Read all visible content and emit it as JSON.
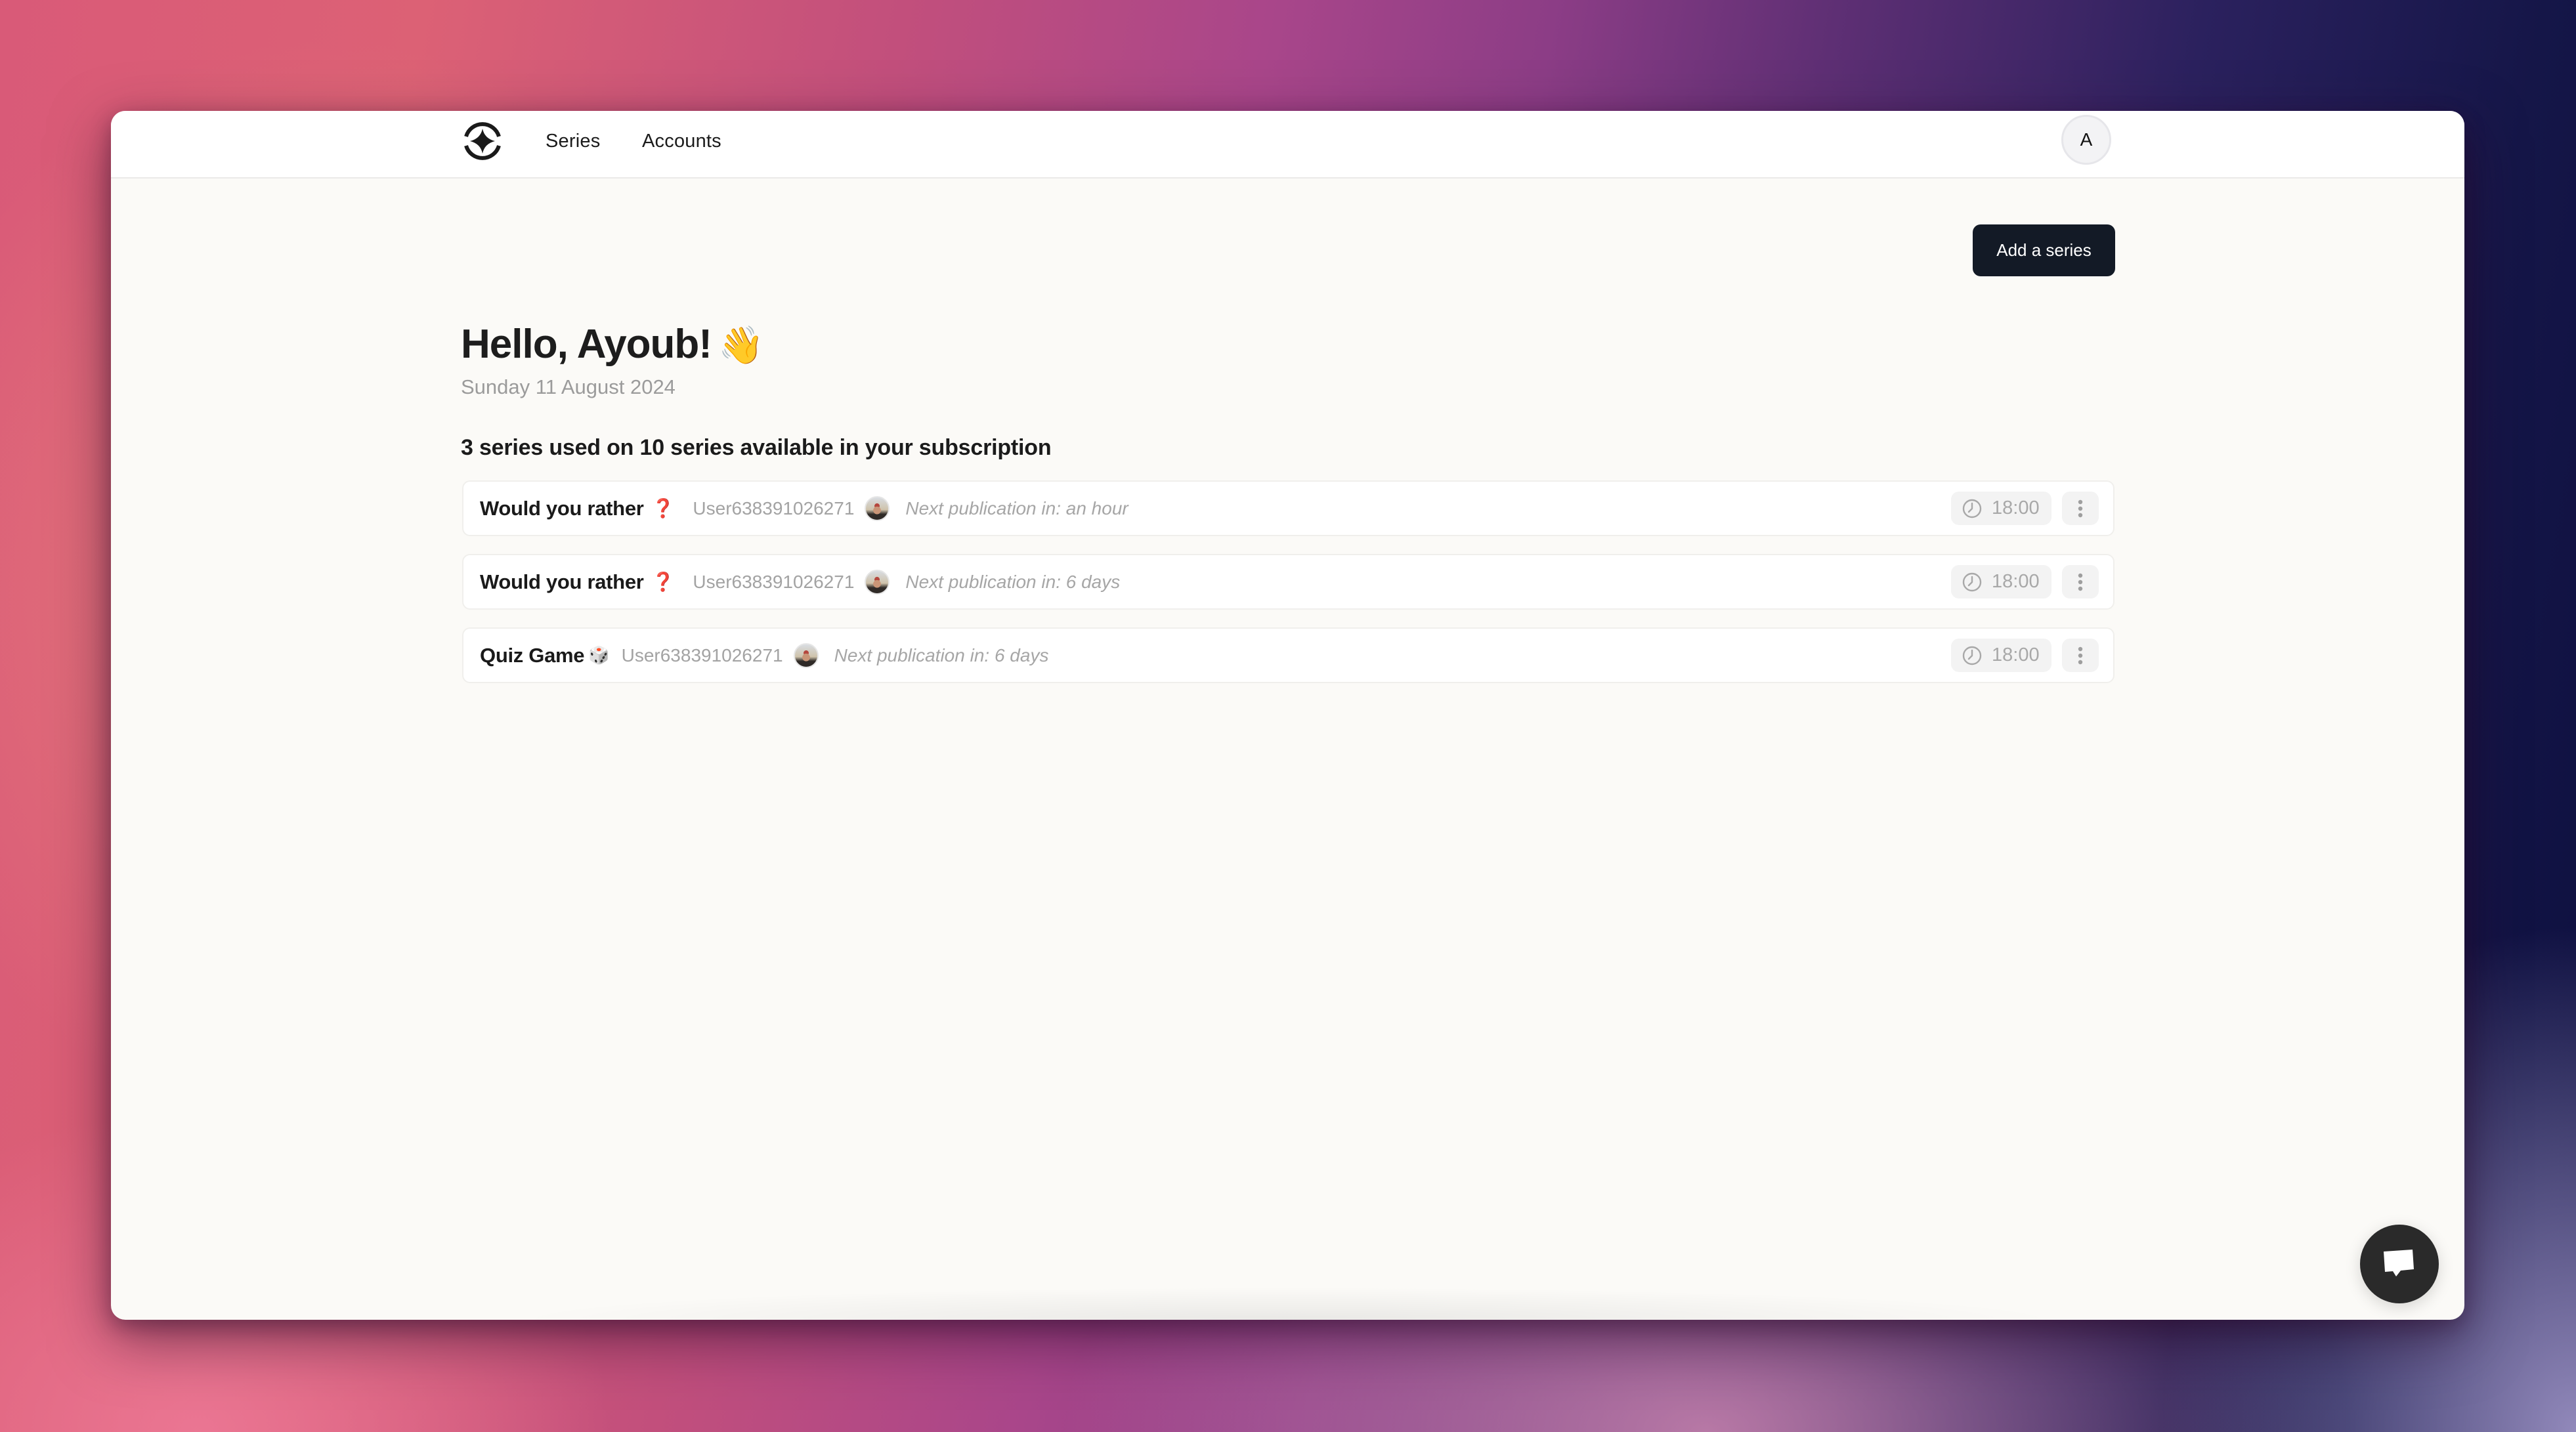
{
  "topbar": {
    "logo": "app-logo",
    "nav": [
      {
        "label": "Series"
      },
      {
        "label": "Accounts"
      }
    ],
    "user_initial": "A"
  },
  "main": {
    "greeting": "Hello, Ayoub!",
    "greeting_emoji": "👋",
    "date": "Sunday 11 August 2024",
    "add_button_label": "Add a series",
    "usage_text": "3 series used on 10 series available in your subscription"
  },
  "series": [
    {
      "name": "Would you rather",
      "emoji": "❓",
      "account": "User638391026271",
      "next_publication": "Next publication in: an hour",
      "time": "18:00"
    },
    {
      "name": "Would you rather",
      "emoji": "❓",
      "account": "User638391026271",
      "next_publication": "Next publication in: 6 days",
      "time": "18:00"
    },
    {
      "name": "Quiz Game",
      "emoji": "🎲",
      "account": "User638391026271",
      "next_publication": "Next publication in: 6 days",
      "time": "18:00"
    }
  ],
  "icons": {
    "clock": "clock-icon",
    "menu": "more-vertical-icon",
    "chat": "chat-bubble-icon"
  },
  "colors": {
    "primary_button": "#131a26",
    "question_emoji": "#d3242b",
    "chat_fab": "#2a2a2a",
    "page_background": "#fbfaf7"
  }
}
